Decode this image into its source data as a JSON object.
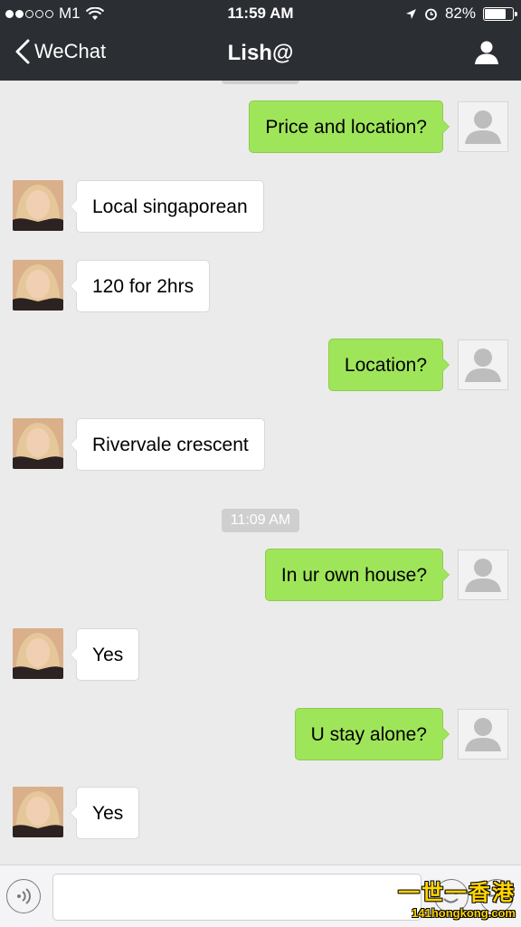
{
  "status_bar": {
    "carrier": "M1",
    "time": "11:59 AM",
    "battery": "82%",
    "battery_level": 0.82
  },
  "nav": {
    "back_label": "WeChat",
    "title": "Lish@"
  },
  "messages": [
    {
      "side": "out",
      "text": "Price and location?"
    },
    {
      "side": "in",
      "text": "Local singaporean"
    },
    {
      "side": "in",
      "text": "120 for 2hrs"
    },
    {
      "side": "out",
      "text": "Location?"
    },
    {
      "side": "in",
      "text": "Rivervale crescent"
    },
    {
      "side": "out",
      "text": "In ur own house?"
    },
    {
      "side": "in",
      "text": "Yes"
    },
    {
      "side": "out",
      "text": "U stay alone?"
    },
    {
      "side": "in",
      "text": "Yes"
    }
  ],
  "timestamp": "11:09 AM",
  "watermark": {
    "main": "一世一香港",
    "sub": "141hongkong.com"
  },
  "icons": {
    "back": "chevron-left-icon",
    "profile": "person-icon",
    "voice": "voice-icon",
    "emoji": "emoji-icon",
    "plus": "plus-icon"
  },
  "colors": {
    "header": "#2b2e33",
    "chat_background": "#ebebeb",
    "outgoing_bubble": "#9fe55a",
    "incoming_bubble": "#ffffff"
  }
}
